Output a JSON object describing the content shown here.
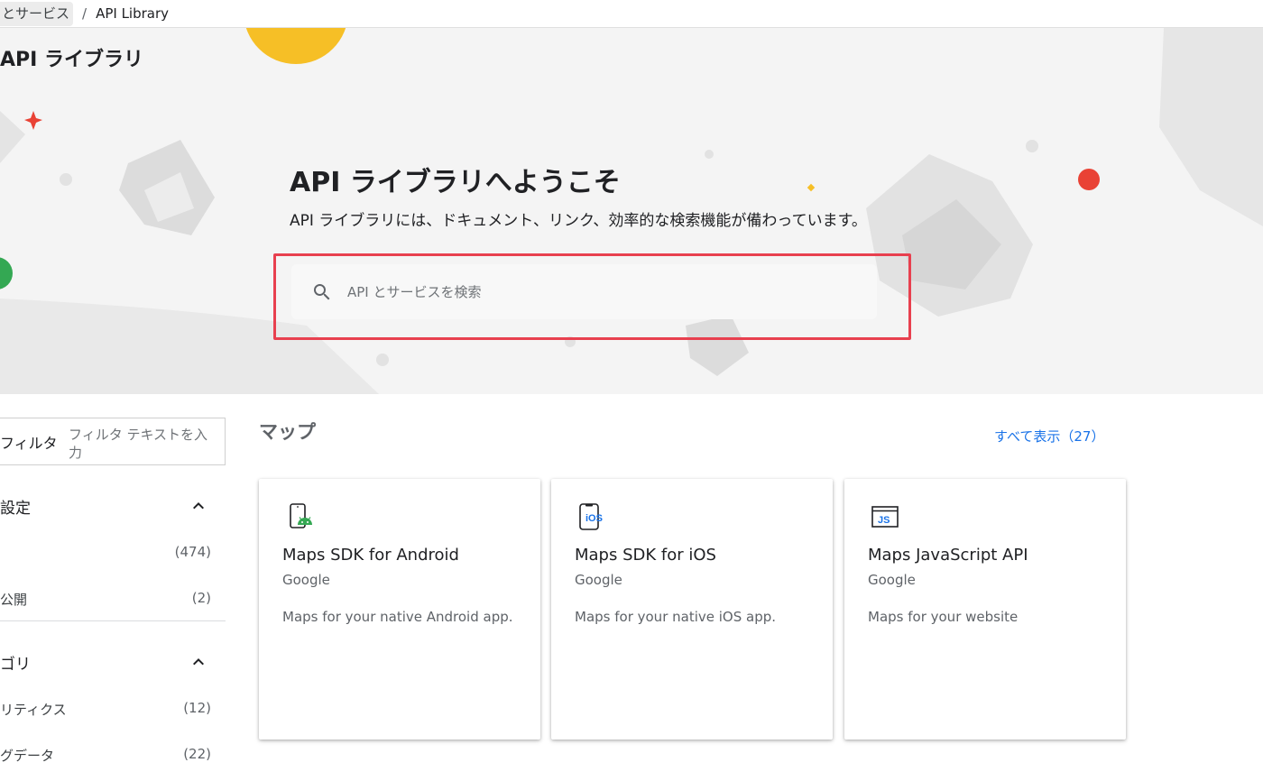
{
  "breadcrumb": {
    "previous": "とサービス",
    "separator": "/",
    "current": "API Library"
  },
  "page": {
    "title": "API ライブラリ"
  },
  "hero": {
    "title": "API ライブラリへようこそ",
    "subtitle": "API ライブラリには、ドキュメント、リンク、効率的な検索機能が備わっています。",
    "search_placeholder": "API とサービスを検索"
  },
  "filter": {
    "label": "フィルタ",
    "placeholder": "フィルタ テキストを入力"
  },
  "sidebar": {
    "sections": [
      {
        "title": "設定",
        "items": [
          {
            "label": "",
            "count": "(474)"
          },
          {
            "label": "公開",
            "count": "(2)"
          }
        ]
      },
      {
        "title": "ゴリ",
        "items": [
          {
            "label": "リティクス",
            "count": "(12)"
          },
          {
            "label": "グデータ",
            "count": "(22)"
          }
        ]
      }
    ]
  },
  "main": {
    "section_title": "マップ",
    "view_all": "すべて表示（27）",
    "cards": [
      {
        "icon": "android-phone-icon",
        "title": "Maps SDK for Android",
        "vendor": "Google",
        "description": "Maps for your native Android app."
      },
      {
        "icon": "ios-icon",
        "title": "Maps SDK for iOS",
        "vendor": "Google",
        "description": "Maps for your native iOS app."
      },
      {
        "icon": "javascript-icon",
        "title": "Maps JavaScript API",
        "vendor": "Google",
        "description": "Maps for your website"
      }
    ]
  },
  "colors": {
    "accent": "#1a73e8",
    "highlight_border": "#e8404f",
    "hero_bg": "#f4f4f4"
  }
}
